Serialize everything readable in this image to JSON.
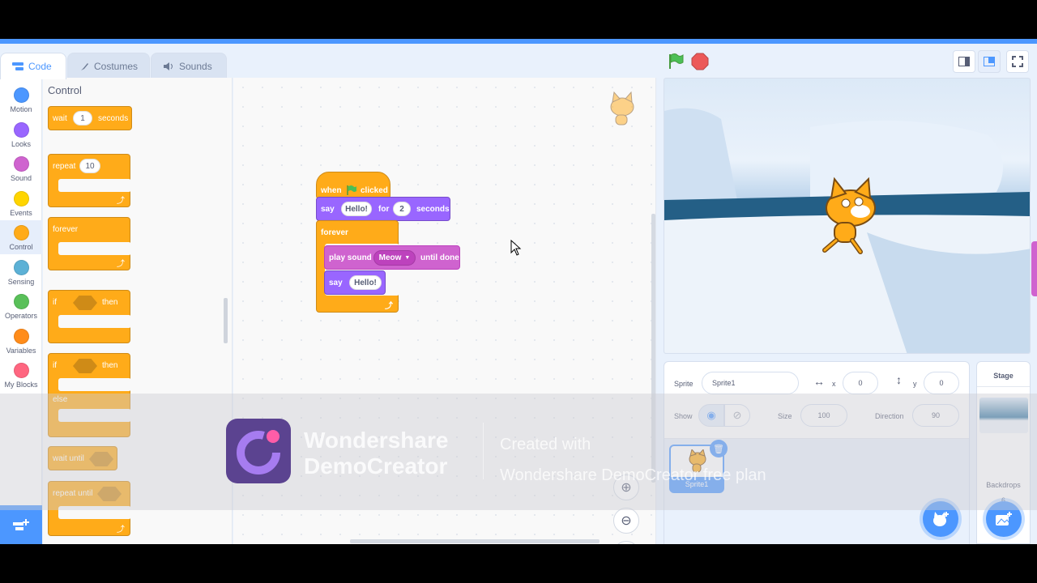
{
  "tabs": [
    {
      "label": "Code",
      "active": true
    },
    {
      "label": "Costumes",
      "active": false
    },
    {
      "label": "Sounds",
      "active": false
    }
  ],
  "categories": [
    {
      "label": "Motion",
      "color": "#4c97ff"
    },
    {
      "label": "Looks",
      "color": "#9966ff"
    },
    {
      "label": "Sound",
      "color": "#cf63cf"
    },
    {
      "label": "Events",
      "color": "#ffd500"
    },
    {
      "label": "Control",
      "color": "#ffab19"
    },
    {
      "label": "Sensing",
      "color": "#5cb1d6"
    },
    {
      "label": "Operators",
      "color": "#59c059"
    },
    {
      "label": "Variables",
      "color": "#ff8c1a"
    },
    {
      "label": "My Blocks",
      "color": "#ff6680"
    }
  ],
  "palette": {
    "title": "Control",
    "wait": {
      "label": "wait",
      "value": "1",
      "unit": "seconds"
    },
    "repeat": {
      "label": "repeat",
      "value": "10"
    },
    "forever": "forever",
    "if_then": {
      "if": "if",
      "then": "then"
    },
    "if_else": {
      "if": "if",
      "then": "then",
      "else": "else"
    },
    "wait_until": "wait until",
    "repeat_until": "repeat until"
  },
  "script": {
    "hat": {
      "when": "when",
      "clicked": "clicked"
    },
    "say_for": {
      "say": "say",
      "msg": "Hello!",
      "for": "for",
      "secs": "2",
      "unit": "seconds"
    },
    "forever": "forever",
    "play_sound": {
      "label": "play sound",
      "sound": "Meow",
      "suffix": "until done"
    },
    "say": {
      "say": "say",
      "msg": "Hello!"
    }
  },
  "sprite_info": {
    "sprite_label": "Sprite",
    "sprite_name": "Sprite1",
    "x_label": "x",
    "x": "0",
    "y_label": "y",
    "y": "0",
    "show_label": "Show",
    "size_label": "Size",
    "size": "100",
    "direction_label": "Direction",
    "direction": "90",
    "thumb_name": "Sprite1"
  },
  "stage_pane": {
    "title": "Stage",
    "backdrops_label": "Backdrops",
    "backdrops_count": "6"
  },
  "watermark": {
    "line1": "Wondershare",
    "line2": "DemoCreator",
    "sub1": "Created with",
    "sub2": "Wondershare DemoCreator free plan"
  },
  "colors": {
    "accent": "#4c97ff",
    "control": "#ffab19",
    "looks": "#9966ff",
    "sound": "#cf63cf"
  }
}
